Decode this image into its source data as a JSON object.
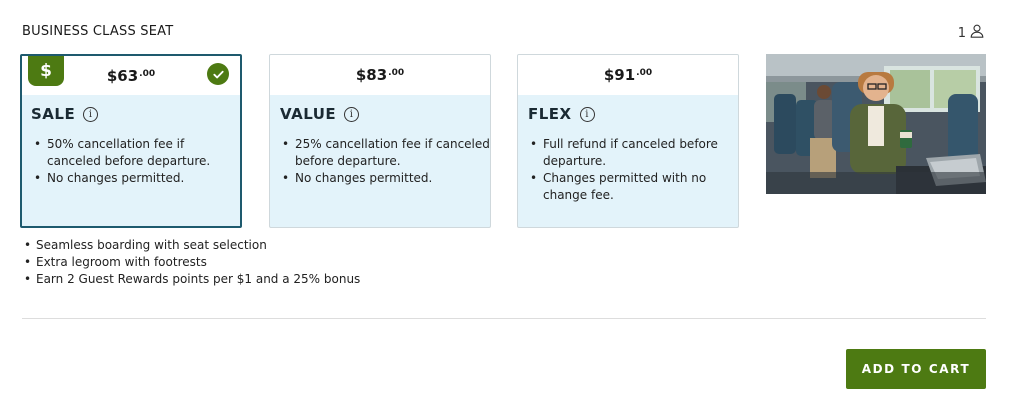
{
  "section_title": "BUSINESS CLASS SEAT",
  "passengers": {
    "count": "1",
    "icon": "person-icon"
  },
  "fares": [
    {
      "name": "SALE",
      "price_main": "$63",
      "price_cents": ".00",
      "selected": true,
      "badge": "$",
      "rules": [
        "50% cancellation fee if canceled before departure.",
        "No changes permitted."
      ]
    },
    {
      "name": "VALUE",
      "price_main": "$83",
      "price_cents": ".00",
      "selected": false,
      "rules": [
        "25% cancellation fee if canceled before departure.",
        "No changes permitted."
      ]
    },
    {
      "name": "FLEX",
      "price_main": "$91",
      "price_cents": ".00",
      "selected": false,
      "rules": [
        "Full refund if canceled before departure.",
        "Changes permitted with no change fee."
      ]
    }
  ],
  "info_glyph": "i",
  "features": [
    "Seamless boarding with seat selection",
    "Extra legroom with footrests",
    "Earn 2 Guest Rewards points per $1 and a 25% bonus"
  ],
  "add_to_cart_label": "ADD TO CART",
  "colors": {
    "brand_green": "#4d7a12",
    "selected_border": "#1e5a6e",
    "card_body": "#e3f3fa"
  }
}
